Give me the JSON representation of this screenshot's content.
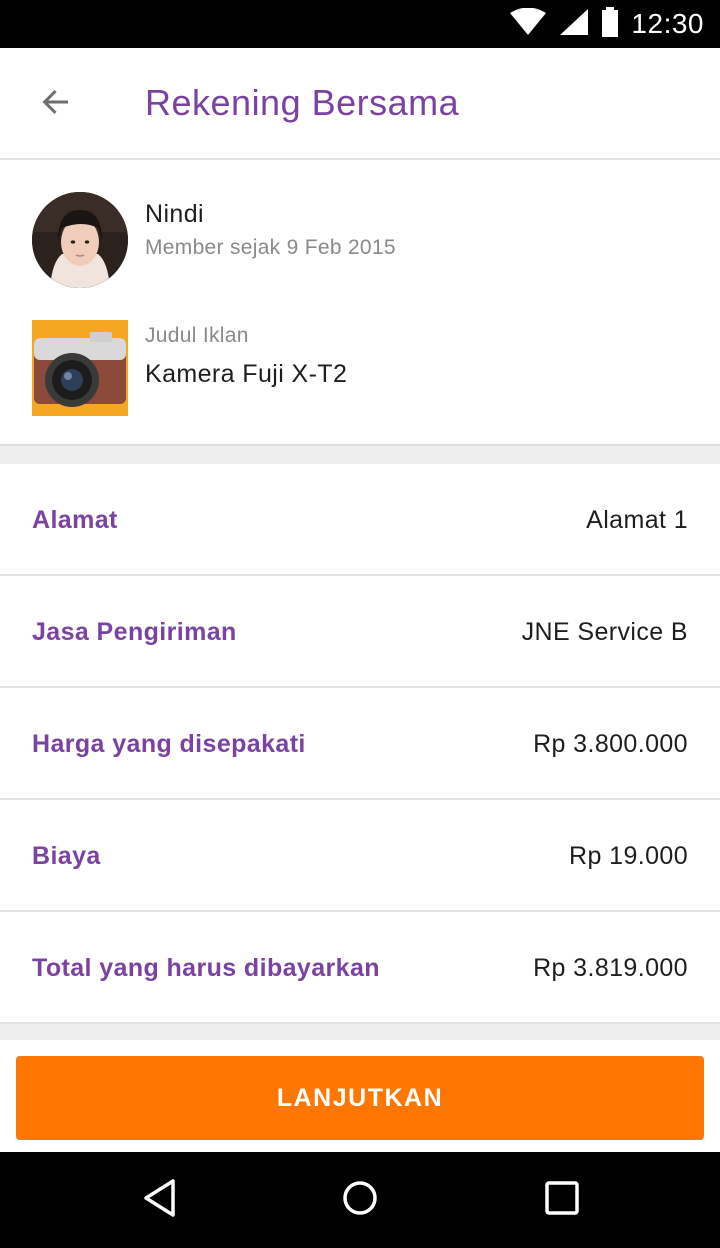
{
  "status_bar": {
    "time": "12:30",
    "icons": [
      "wifi-icon",
      "signal-icon",
      "battery-icon"
    ]
  },
  "app_bar": {
    "back_icon": "arrow-left-icon",
    "title": "Rekening Bersama"
  },
  "seller": {
    "name": "Nindi",
    "member_since": "Member sejak 9 Feb 2015"
  },
  "ad": {
    "label": "Judul Iklan",
    "title": "Kamera Fuji X-T2"
  },
  "details": [
    {
      "label": "Alamat",
      "value": "Alamat 1"
    },
    {
      "label": "Jasa Pengiriman",
      "value": "JNE Service B"
    },
    {
      "label": "Harga yang disepakati",
      "value": "Rp 3.800.000"
    },
    {
      "label": "Biaya",
      "value": "Rp 19.000"
    },
    {
      "label": "Total yang harus dibayarkan",
      "value": "Rp 3.819.000"
    }
  ],
  "action": {
    "button_label": "LANJUTKAN"
  },
  "nav_bar": {
    "icons": [
      "nav-back-icon",
      "nav-home-icon",
      "nav-recents-icon"
    ]
  },
  "colors": {
    "accent_purple": "#7a43a0",
    "cta_orange": "#ff7600",
    "text_dark": "#1e1e1e",
    "text_muted": "#8a8a8a"
  }
}
